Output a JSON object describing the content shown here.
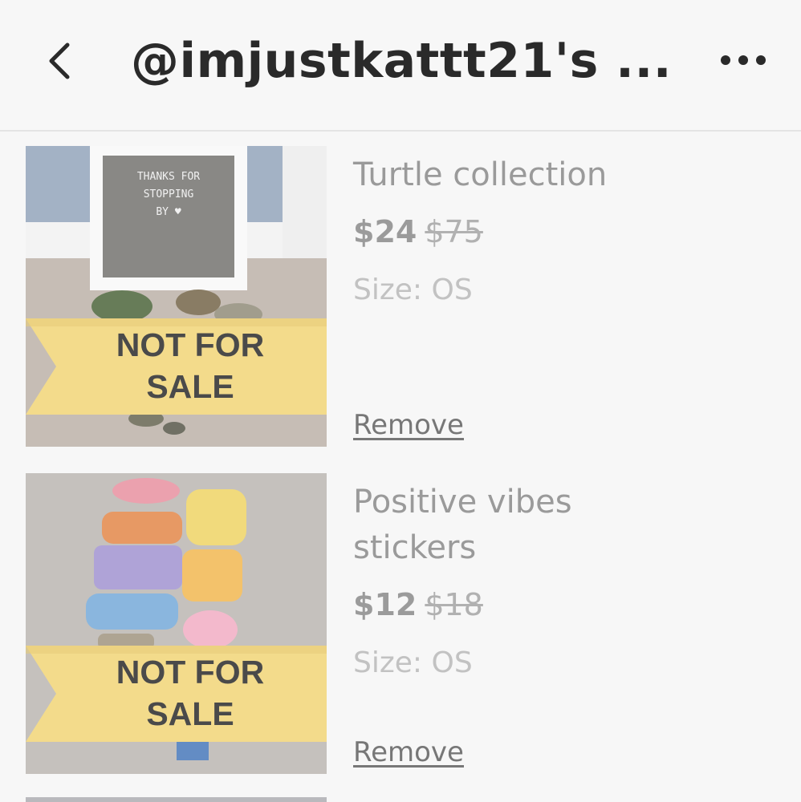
{
  "header": {
    "back_icon": "chevron-left-icon",
    "title": "@imjustkattt21's ...",
    "more_icon": "more-horizontal-icon"
  },
  "items": [
    {
      "title": "Turtle collection",
      "price": "$24",
      "original_price": "$75",
      "size_label": "Size:",
      "size_value": "OS",
      "ribbon_line1": "NOT FOR",
      "ribbon_line2": "SALE",
      "remove_label": "Remove",
      "board_text_line1": "THANKS   FOR",
      "board_text_line2": "STOPPING",
      "board_text_line3": "BY ♥"
    },
    {
      "title": "Positive vibes stickers",
      "price": "$12",
      "original_price": "$18",
      "size_label": "Size:",
      "size_value": "OS",
      "ribbon_line1": "NOT FOR",
      "ribbon_line2": "SALE",
      "remove_label": "Remove"
    }
  ],
  "colors": {
    "ribbon": "#f3d46e",
    "background": "#f7f7f7"
  }
}
